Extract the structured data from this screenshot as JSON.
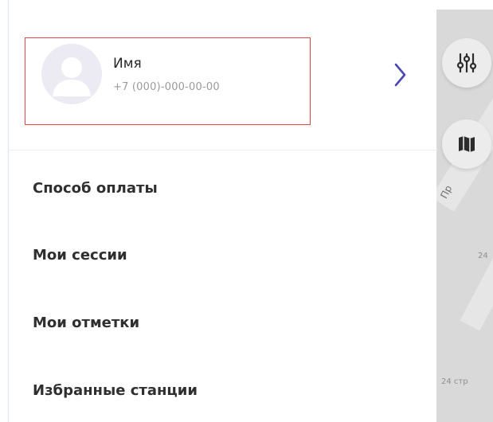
{
  "profile": {
    "name": "Имя",
    "phone": "+7 (000)-000-00-00"
  },
  "menu": {
    "items": [
      {
        "label": "Способ оплаты"
      },
      {
        "label": "Мои сессии"
      },
      {
        "label": "Мои отметки"
      },
      {
        "label": "Избранные станции"
      }
    ]
  },
  "map": {
    "labels": [
      "Пр",
      "24",
      "24 стр"
    ]
  },
  "icons": {
    "chevron": "chevron-right-icon",
    "filters": "sliders-icon",
    "layers": "map-icon"
  },
  "colors": {
    "chevron": "#4b47b3",
    "highlight_border": "#e3454a",
    "avatar_bg": "#ecebf3",
    "map_bg": "#d9d9d9"
  }
}
